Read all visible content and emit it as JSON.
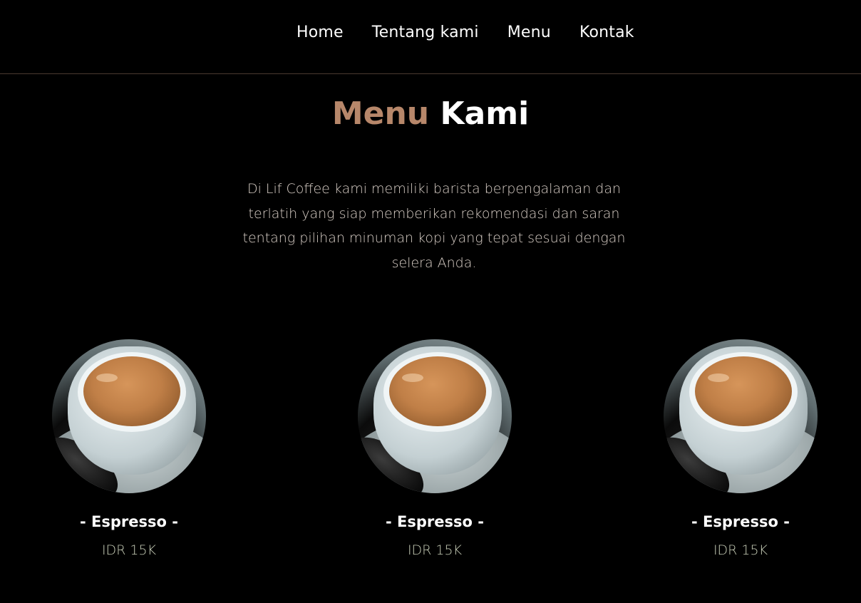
{
  "nav": {
    "items": [
      {
        "label": "Home"
      },
      {
        "label": "Tentang kami"
      },
      {
        "label": "Menu"
      },
      {
        "label": "Kontak"
      }
    ]
  },
  "section": {
    "title_accent": "Menu",
    "title_plain": "Kami",
    "description": "Di Lif Coffee kami memiliki barista berpengalaman dan terlatih yang siap memberikan rekomendasi dan saran tentang pilihan minuman kopi yang tepat sesuai dengan selera Anda.",
    "accent_color": "#b7876a"
  },
  "menu_items": [
    {
      "name": "- Espresso -",
      "price": "IDR 15K",
      "image": "espresso-cup-image"
    },
    {
      "name": "- Espresso -",
      "price": "IDR 15K",
      "image": "espresso-cup-image"
    },
    {
      "name": "- Espresso -",
      "price": "IDR 15K",
      "image": "espresso-cup-image"
    }
  ]
}
